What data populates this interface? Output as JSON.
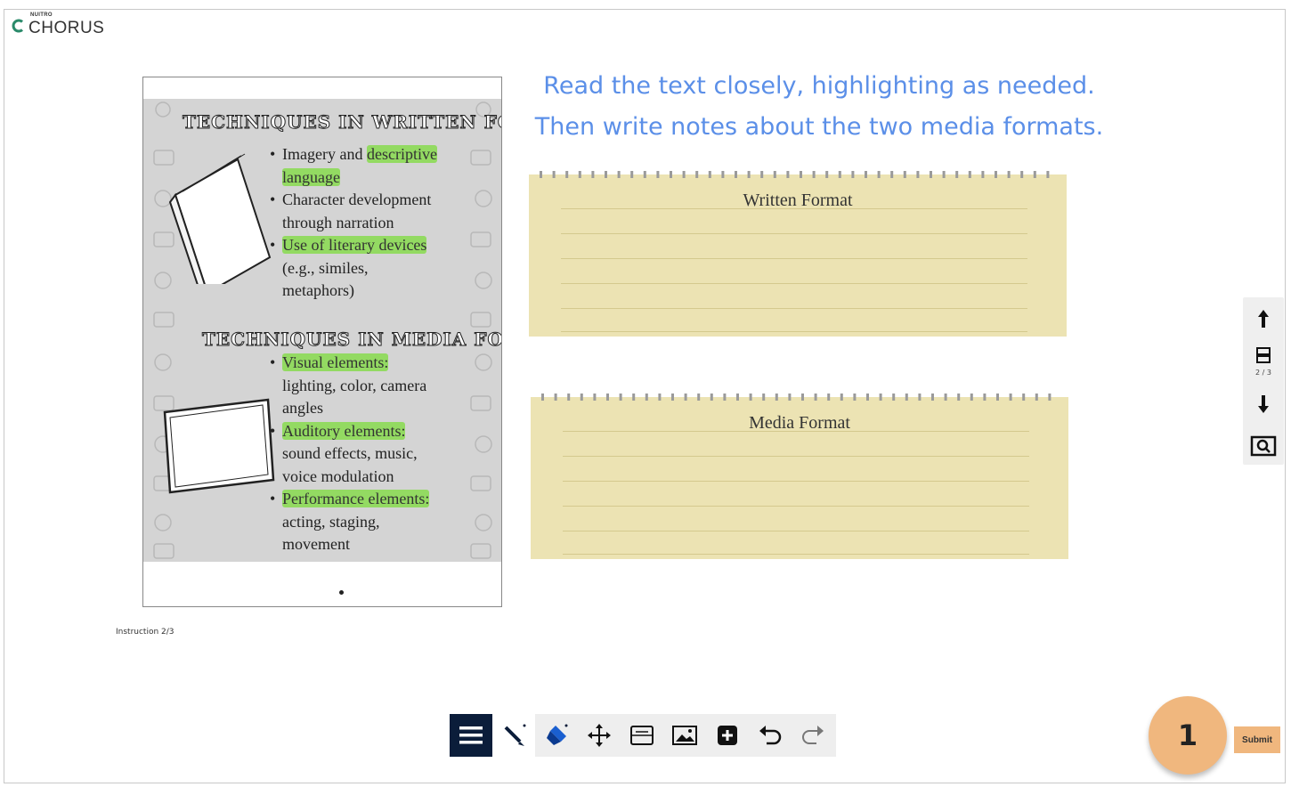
{
  "app": {
    "logo_small": "NUITRO",
    "logo_main": "CHORUS"
  },
  "document": {
    "written_heading": "TECHNIQUES IN WRITTEN FORM",
    "written_bullets": [
      {
        "parts": [
          {
            "t": "Imagery and "
          },
          {
            "t": "descriptive",
            "hl": true
          }
        ]
      },
      {
        "parts": [
          {
            "t": "language",
            "hl": true
          }
        ],
        "cont": true
      },
      {
        "parts": [
          {
            "t": "Character development"
          }
        ]
      },
      {
        "parts": [
          {
            "t": "through narration"
          }
        ],
        "cont": true
      },
      {
        "parts": [
          {
            "t": "Use of literary devices",
            "hl": true
          }
        ]
      },
      {
        "parts": [
          {
            "t": "(e.g., similes,"
          }
        ],
        "cont": true
      },
      {
        "parts": [
          {
            "t": "metaphors)"
          }
        ],
        "cont": true
      }
    ],
    "media_heading": "TECHNIQUES IN MEDIA FORM",
    "media_bullets": [
      {
        "parts": [
          {
            "t": "Visual elements:",
            "hl": true
          }
        ]
      },
      {
        "parts": [
          {
            "t": "lighting, color, camera"
          }
        ],
        "cont": true
      },
      {
        "parts": [
          {
            "t": "angles"
          }
        ],
        "cont": true
      },
      {
        "parts": [
          {
            "t": "Auditory elements:",
            "hl": true
          }
        ]
      },
      {
        "parts": [
          {
            "t": "sound effects, music,"
          }
        ],
        "cont": true
      },
      {
        "parts": [
          {
            "t": "voice modulation"
          }
        ],
        "cont": true
      },
      {
        "parts": [
          {
            "t": "Performance elements:",
            "hl": true
          }
        ]
      },
      {
        "parts": [
          {
            "t": "acting, staging,"
          }
        ],
        "cont": true
      },
      {
        "parts": [
          {
            "t": "movement"
          }
        ],
        "cont": true
      }
    ]
  },
  "instructions": {
    "line1": "Read the text closely, highlighting as needed.",
    "line2": "Then write notes about the two media formats."
  },
  "notepads": {
    "written_title": "Written Format",
    "media_title": "Media Format"
  },
  "page_label": "Instruction 2/3",
  "side_toolbar": {
    "page_indicator": "2 / 3",
    "icons": [
      "arrow-up-icon",
      "slide-icon",
      "arrow-down-icon",
      "zoom-icon"
    ]
  },
  "bottom_toolbar": {
    "icons": [
      "menu-icon",
      "pen-icon",
      "highlighter-icon",
      "move-icon",
      "text-box-icon",
      "image-icon",
      "add-icon",
      "undo-icon",
      "redo-icon"
    ]
  },
  "badge": {
    "count": "1"
  },
  "submit_label": "Submit",
  "colors": {
    "accent_text": "#5b8fe8",
    "notepad": "#ece3b3",
    "badge": "#f0b77e",
    "highlight": "#7ddc3c",
    "toolbar_active": "#0b1d3a"
  }
}
